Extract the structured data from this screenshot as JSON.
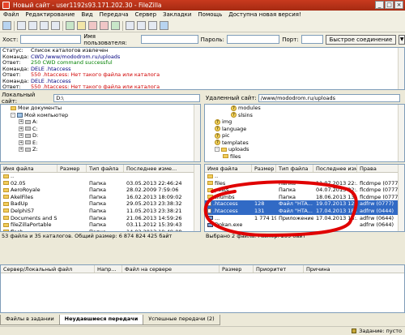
{
  "window": {
    "title": "Новый сайт - user1192s93.171.202.30 - FileZilla"
  },
  "menu": [
    "Файл",
    "Редактирование",
    "Вид",
    "Передача",
    "Сервер",
    "Закладки",
    "Помощь",
    "Доступна новая версия!"
  ],
  "quickconnect": {
    "host_label": "Хост:",
    "user_label": "Имя пользователя:",
    "pass_label": "Пароль:",
    "port_label": "Порт:",
    "button_label": "Быстрое соединение"
  },
  "log": [
    {
      "kind": "Статус:",
      "text": "Список каталогов извлечен",
      "color": "black"
    },
    {
      "kind": "Команда:",
      "text": "CWD /www/mododrom.ru/uploads",
      "color": "blue"
    },
    {
      "kind": "Ответ:",
      "text": "250 CWD command successful",
      "color": "green"
    },
    {
      "kind": "Команда:",
      "text": "DELE .htaccess",
      "color": "blue"
    },
    {
      "kind": "Ответ:",
      "text": "550 .htaccess: Нет такого файла или каталога",
      "color": "red"
    },
    {
      "kind": "Команда:",
      "text": "DELE .htaccess",
      "color": "blue"
    },
    {
      "kind": "Ответ:",
      "text": "550 .htaccess: Нет такого файла или каталога",
      "color": "red"
    }
  ],
  "local": {
    "site_label": "Локальный сайт:",
    "path": "D:\\",
    "tree": [
      {
        "label": "Мои документы",
        "indent": 1,
        "icon": "folder"
      },
      {
        "label": "Мой компьютер",
        "indent": 1,
        "icon": "pc",
        "expand": "-"
      },
      {
        "label": "A:",
        "indent": 2,
        "icon": "drive",
        "expand": "+"
      },
      {
        "label": "C:",
        "indent": 2,
        "icon": "drive",
        "expand": "+"
      },
      {
        "label": "D:",
        "indent": 2,
        "icon": "drive",
        "expand": "+"
      },
      {
        "label": "E:",
        "indent": 2,
        "icon": "drive",
        "expand": "+"
      },
      {
        "label": "Z:",
        "indent": 2,
        "icon": "drive",
        "expand": "+"
      }
    ],
    "columns": [
      "Имя файла",
      "Размер",
      "Тип файла",
      "Последнее изме..."
    ],
    "files": [
      {
        "name": "..",
        "size": "",
        "type": "",
        "modified": ""
      },
      {
        "name": "02.05",
        "size": "",
        "type": "Папка",
        "modified": "03.05.2013 22:46:24"
      },
      {
        "name": "AeroRoyale",
        "size": "",
        "type": "Папка",
        "modified": "28.02.2009 7:59:06"
      },
      {
        "name": "AkelFiles",
        "size": "",
        "type": "Папка",
        "modified": "16.02.2013 18:09:02"
      },
      {
        "name": "BadUp",
        "size": "",
        "type": "Папка",
        "modified": "29.05.2013 23:38:32"
      },
      {
        "name": "DelphiS7",
        "size": "",
        "type": "Папка",
        "modified": "11.05.2013 23:38:21"
      },
      {
        "name": "Documents and S...",
        "size": "",
        "type": "Папка",
        "modified": "21.06.2013 14:59:26"
      },
      {
        "name": "fileZillaPortable",
        "size": "",
        "type": "Папка",
        "modified": "03.11.2012 15:39:43"
      },
      {
        "name": "flash",
        "size": "",
        "type": "Папка",
        "modified": "14.02.2013 19:49:08"
      },
      {
        "name": "Ilartinki",
        "size": "",
        "type": "Папка",
        "modified": "14.02.2013 19:49:08"
      }
    ],
    "status": "53 файла и 35 каталогов. Общий размер: 6 874 824 425 байт"
  },
  "remote": {
    "site_label": "Удаленный сайт:",
    "path": "/www/mododrom.ru/uploads",
    "tree": [
      {
        "label": "modules",
        "indent": 3,
        "icon": "question"
      },
      {
        "label": "slsins",
        "indent": 3,
        "icon": "question"
      },
      {
        "label": "img",
        "indent": 1,
        "icon": "question"
      },
      {
        "label": "language",
        "indent": 1,
        "icon": "question"
      },
      {
        "label": "pic",
        "indent": 1,
        "icon": "question"
      },
      {
        "label": "templates",
        "indent": 1,
        "icon": "question"
      },
      {
        "label": "uploads",
        "indent": 1,
        "icon": "folder",
        "expand": "-"
      },
      {
        "label": "files",
        "indent": 2,
        "icon": "folder"
      }
    ],
    "columns": [
      "Имя файла",
      "Размер",
      "Тип файла",
      "Последнее изм...",
      "Права"
    ],
    "files": [
      {
        "name": "..",
        "size": "",
        "type": "",
        "modified": "",
        "perms": "",
        "icon": "folder",
        "selected": false
      },
      {
        "name": "files",
        "size": "",
        "type": "Папка",
        "modified": "11.07.2013 22:...",
        "perms": "flcdmpe (0777)",
        "icon": "folder",
        "selected": false
      },
      {
        "name": "posts",
        "size": "",
        "type": "Папка",
        "modified": "04.07.2013 22:...",
        "perms": "flcdmpe (0777)",
        "icon": "folder",
        "selected": false
      },
      {
        "name": "thumbs",
        "size": "",
        "type": "Папка",
        "modified": "18.06.2013 13:...",
        "perms": "flcdmpe (0777)",
        "icon": "folder",
        "selected": false
      },
      {
        "name": ".htaccess",
        "size": "128",
        "type": "Файл \"HTA...",
        "modified": "19.07.2013 12:...",
        "perms": "adfrw (0777)",
        "icon": "file",
        "selected": true
      },
      {
        "name": ".htaccess",
        "size": "131",
        "type": "Файл \"HTA...",
        "modified": "17.04.2013 18:...",
        "perms": "adfrw (0444)",
        "icon": "file",
        "selected": true
      },
      {
        "name": "...",
        "size": "1 774 194",
        "type": "Приложение",
        "modified": "17.04.2013 18:...",
        "perms": "adfrw (0644)",
        "icon": "exe",
        "selected": false
      },
      {
        "name": "Dokan.exe",
        "size": "",
        "type": "",
        "modified": "",
        "perms": "adfrw (0644)",
        "icon": "exe",
        "selected": false
      }
    ],
    "status": "Выбрано 2 файла. Размер: 259 байт"
  },
  "queue": {
    "columns": [
      "Сервер/Локальный файл",
      "Напр...",
      "Файл на сервере",
      "Размер",
      "Приоритет",
      "Причина"
    ]
  },
  "tabs": [
    "Файлы в задании",
    "Неудавшиеся передачи",
    "Успешные передачи (2)"
  ],
  "statusbar": {
    "text": "Задание: пусто"
  },
  "colors": {
    "annotation": "#e00000",
    "selection": "#316ac5",
    "title_bg": "#b53018"
  }
}
